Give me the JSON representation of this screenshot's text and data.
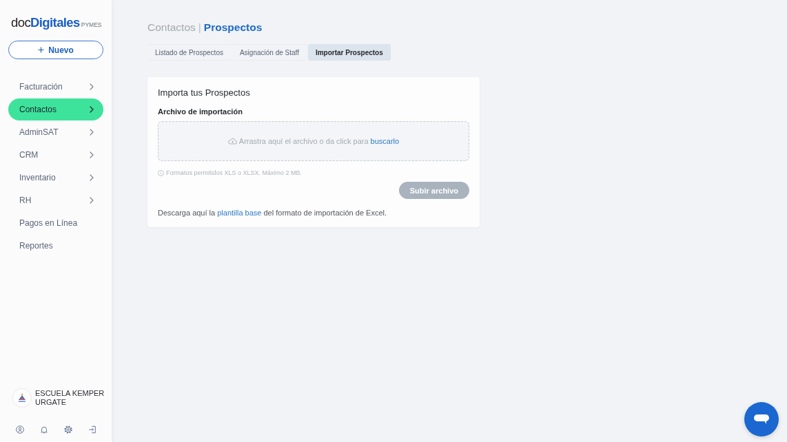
{
  "sidebar": {
    "logo": {
      "wordmark": "doc**Digitales**",
      "suffix": "PYMES"
    },
    "new_button": {
      "label": "Nuevo"
    },
    "menu": [
      {
        "label": "Facturación",
        "kind": "submenu",
        "selected": false
      },
      {
        "label": "Contactos",
        "kind": "submenu",
        "selected": true
      },
      {
        "label": "AdminSAT",
        "kind": "submenu",
        "selected": false
      },
      {
        "label": "CRM",
        "kind": "submenu",
        "selected": false
      },
      {
        "label": "Inventario",
        "kind": "submenu",
        "selected": false
      },
      {
        "label": "RH",
        "kind": "submenu",
        "selected": false
      },
      {
        "label": "Pagos en Línea",
        "kind": "link",
        "selected": false
      },
      {
        "label": "Reportes",
        "kind": "link",
        "selected": false
      }
    ],
    "account": {
      "name": "ESCUELA KEMPER URGATE"
    }
  },
  "header": {
    "section": "Contactos",
    "separator": "|",
    "page": "Prospectos"
  },
  "tabs": [
    {
      "label": "Listado de Prospectos",
      "selected": false
    },
    {
      "label": "Asignación de Staff",
      "selected": false
    },
    {
      "label": "Importar Prospectos",
      "selected": true
    }
  ],
  "import_card": {
    "title": "Importa tus Prospectos",
    "field_label": "Archivo de importación",
    "dropzone": {
      "text": "Arrastra aquí el archivo o da click para",
      "link": "buscarlo"
    },
    "hint": "Formatos permitidos XLS o XLSX. Máximo 2 MB.",
    "upload_button": {
      "label": "Subir archivo",
      "disabled": true
    },
    "template_note": {
      "before": "Descarga aquí la",
      "link": "plantilla base",
      "after": "del formato de importación de Excel."
    }
  }
}
